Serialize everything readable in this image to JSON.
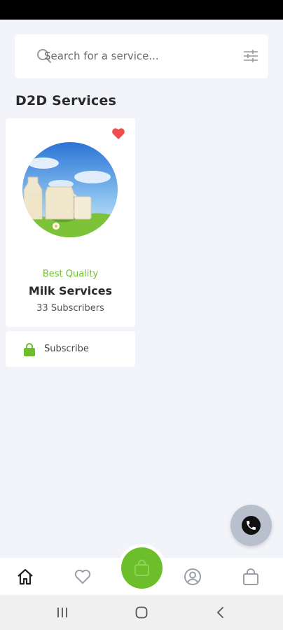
{
  "search": {
    "placeholder": "Search for a service..."
  },
  "section": {
    "title": "D2D Services"
  },
  "service_card": {
    "tag": "Best Quality",
    "name": "Milk Services",
    "subscribers": "33 Subscribers",
    "favorited": true,
    "subscribe_label": "Subscribe"
  },
  "bottom_nav": {
    "items": [
      "home-icon",
      "heart-icon",
      "user-icon",
      "bag-icon"
    ],
    "center": "bag-icon"
  },
  "colors": {
    "accent": "#6cbf2b",
    "favorite": "#f04e4e",
    "background": "#f2f4f9"
  }
}
